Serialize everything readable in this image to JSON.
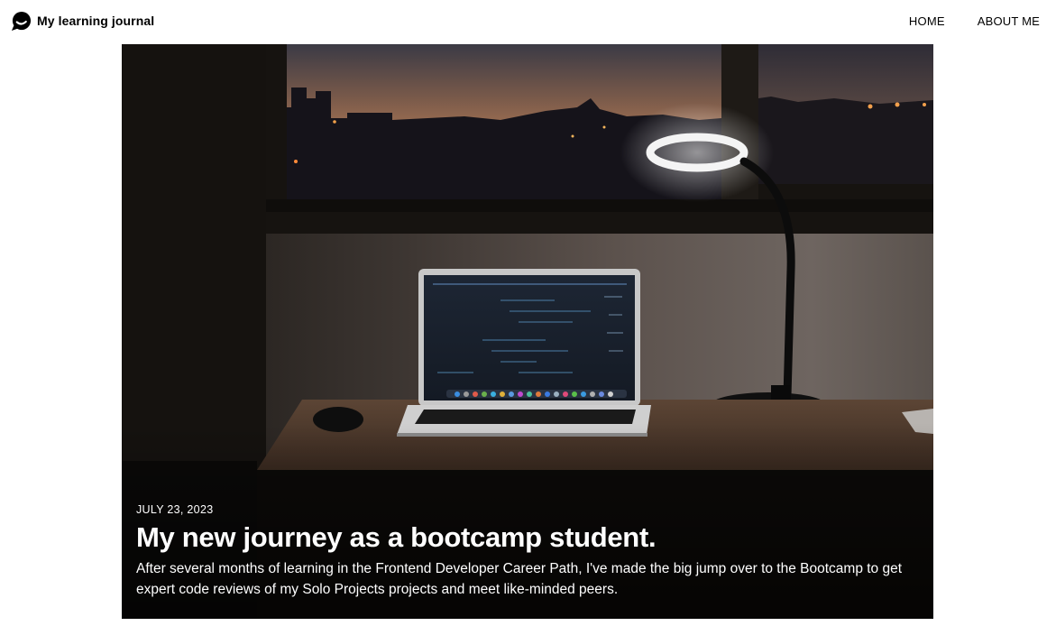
{
  "header": {
    "brand": {
      "icon": "chat-bubble-icon",
      "name": "My learning journal"
    },
    "nav": [
      {
        "label": "HOME"
      },
      {
        "label": "ABOUT ME"
      }
    ]
  },
  "hero": {
    "image": "laptop-on-desk-with-lamp-at-dusk",
    "date": "JULY 23, 2023",
    "title": "My new journey as a bootcamp student.",
    "excerpt": "After several months of learning in the Frontend Developer Career Path, I've made the big jump over to the Bootcamp to get expert code reviews of my Solo Projects projects and meet like-minded peers."
  },
  "colors": {
    "background": "#ffffff",
    "text": "#000000",
    "hero_text": "#ffffff"
  }
}
